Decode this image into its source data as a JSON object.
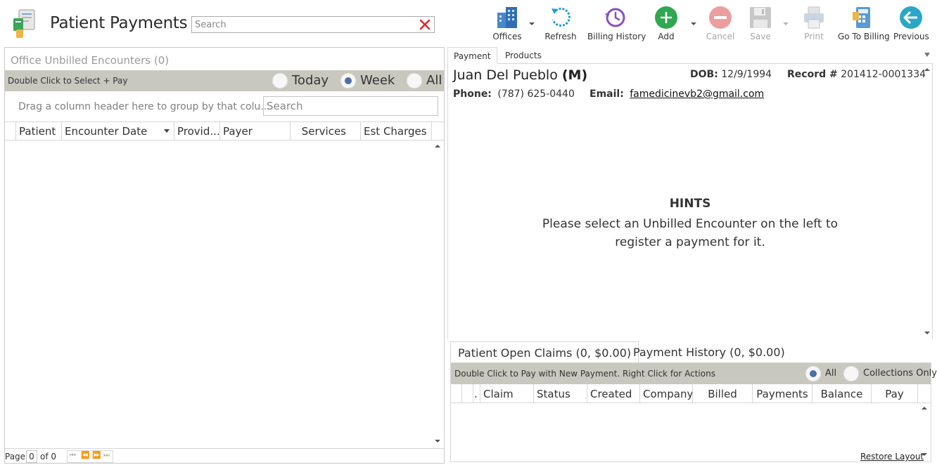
{
  "app": {
    "title": "Patient Payments",
    "search_placeholder": "Search"
  },
  "toolbar": {
    "offices": "Offices",
    "refresh": "Refresh",
    "billing_history": "Billing History",
    "add": "Add",
    "cancel": "Cancel",
    "save": "Save",
    "print": "Print",
    "go_to_billing": "Go To Billing",
    "previous": "Previous"
  },
  "left": {
    "title": "Office Unbilled Encounters (0)",
    "hint": "Double Click to Select + Pay",
    "filters": [
      {
        "label": "Today",
        "selected": false
      },
      {
        "label": "Week",
        "selected": true
      },
      {
        "label": "All",
        "selected": false
      }
    ],
    "group_hint": "Drag a column header here to group by that colu...",
    "search_placeholder": "Search",
    "columns": [
      "Patient",
      "Encounter Date",
      "Provid...",
      "Payer",
      "Services",
      "Est Charges"
    ],
    "footer": {
      "page_label": "Page",
      "page_value": "0",
      "of_label": "of 0"
    }
  },
  "right": {
    "tabs": [
      "Payment",
      "Products"
    ],
    "active_tab": "Payment",
    "patient": {
      "name": "Juan Del Pueblo",
      "sex": "(M)",
      "dob_label": "DOB:",
      "dob": "12/9/1994",
      "record_label": "Record #",
      "record": "201412-0001334",
      "phone_label": "Phone:",
      "phone": "(787) 625-0440",
      "email_label": "Email:",
      "email": "famedicinevb2@gmail.com"
    },
    "hints": {
      "title": "HINTS",
      "text": "Please select an Unbilled Encounter on the left to register a payment for it."
    },
    "bottom_tabs": [
      "Patient Open Claims (0, $0.00)",
      "Payment History (0, $0.00)"
    ],
    "bottom_hint": "Double Click to Pay with New Payment. Right Click for Actions",
    "bottom_filters": [
      {
        "label": "All",
        "selected": true
      },
      {
        "label": "Collections Only",
        "selected": false
      }
    ],
    "claim_columns": [
      ".",
      "Claim",
      "Status",
      "Created",
      "Company",
      "Billed",
      "Payments",
      "Balance",
      "Pay"
    ],
    "restore_layout": "Restore Layout"
  },
  "colors": {
    "grid_bar": "#c9c8bf",
    "radio_selected": "#4d6fa8",
    "add_green": "#2fa84f",
    "cancel_red": "#e89a9a",
    "refresh_blue": "#1e9bd7",
    "history_purple": "#8a4fc2",
    "previous_teal": "#2aa7c8"
  }
}
